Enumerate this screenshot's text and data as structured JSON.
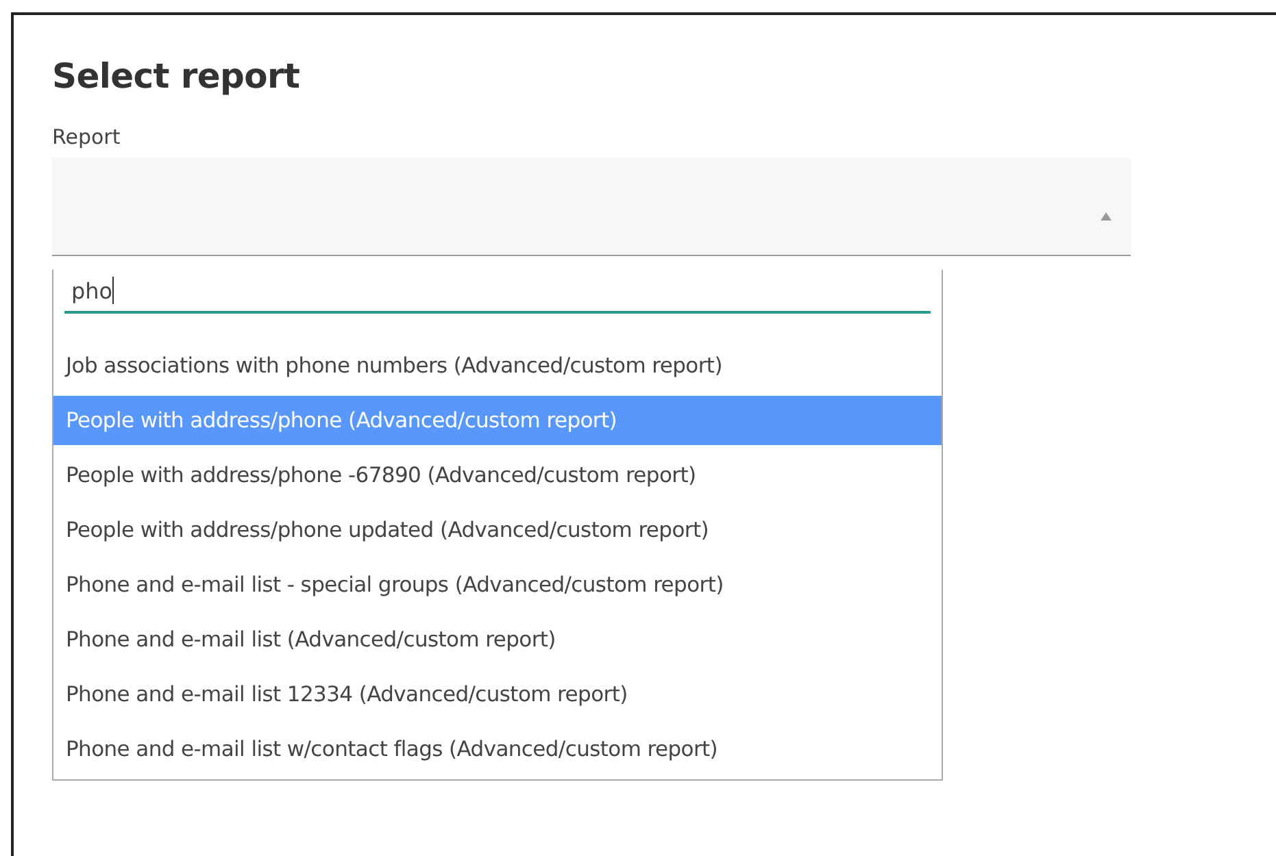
{
  "title": "Select report",
  "report_field": {
    "label": "Report",
    "expanded": true
  },
  "dropdown": {
    "search": {
      "value": "pho"
    },
    "options": [
      {
        "label": "Job associations with phone numbers (Advanced/custom report)",
        "selected": false
      },
      {
        "label": "People with address/phone (Advanced/custom report)",
        "selected": true
      },
      {
        "label": "People with address/phone -67890 (Advanced/custom report)",
        "selected": false
      },
      {
        "label": "People with address/phone updated (Advanced/custom report)",
        "selected": false
      },
      {
        "label": "Phone and e-mail list - special groups (Advanced/custom report)",
        "selected": false
      },
      {
        "label": "Phone and e-mail list (Advanced/custom report)",
        "selected": false
      },
      {
        "label": "Phone and e-mail list 12334 (Advanced/custom report)",
        "selected": false
      },
      {
        "label": "Phone and e-mail list w/contact flags (Advanced/custom report)",
        "selected": false
      }
    ]
  }
}
